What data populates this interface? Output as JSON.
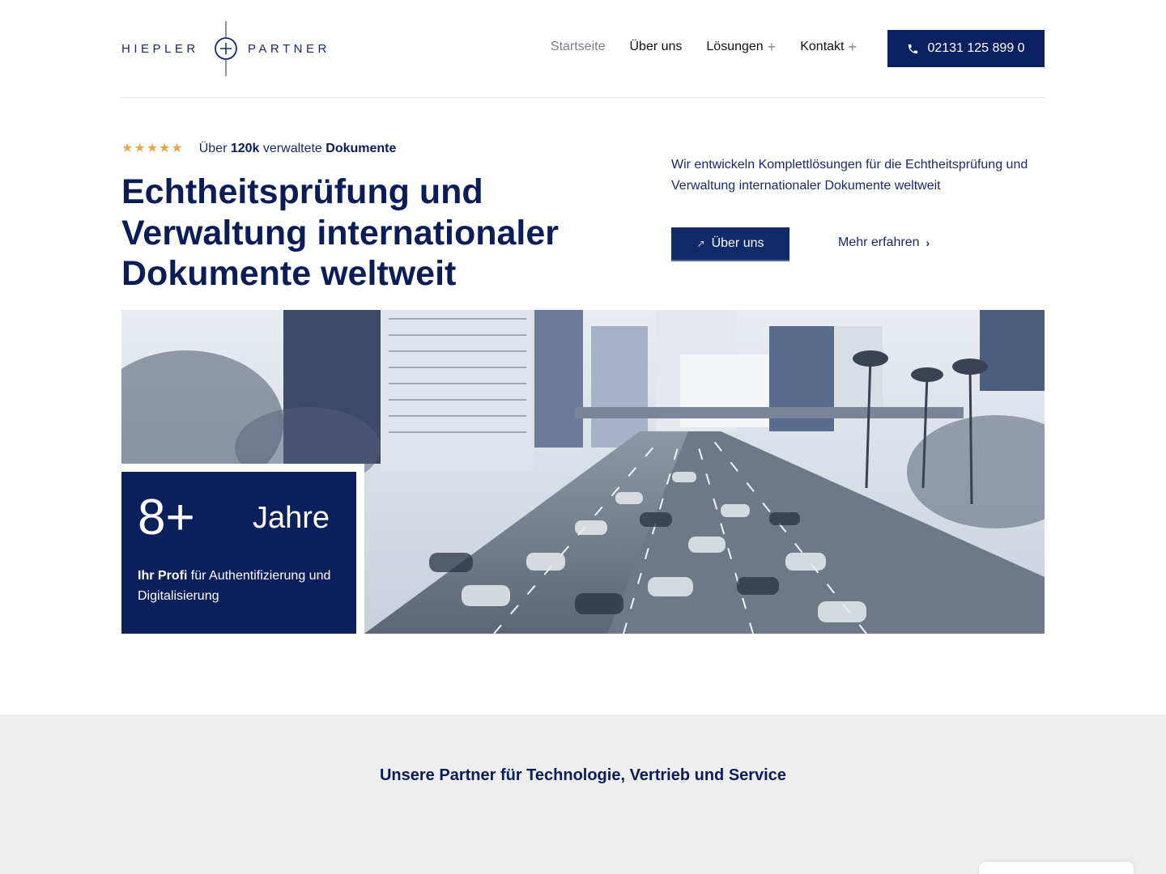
{
  "header": {
    "logo_left": "HIEPLER",
    "logo_right": "PARTNER",
    "nav": [
      {
        "label": "Startseite",
        "has_plus": false,
        "active": true
      },
      {
        "label": "Über uns",
        "has_plus": false,
        "active": false
      },
      {
        "label": "Lösungen",
        "has_plus": true,
        "active": false
      },
      {
        "label": "Kontakt",
        "has_plus": true,
        "active": false
      }
    ],
    "phone": "02131 125 899 0"
  },
  "hero": {
    "rating_prefix": "Über",
    "rating_count": "120k",
    "rating_mid": "verwaltete",
    "rating_suffix": "Dokumente",
    "headline_b1": "Echtheitsprüfung",
    "headline_t1": "und",
    "headline_b2": "Verwaltung",
    "headline_t2": "internationaler Dokumente weltweit",
    "intro": "Wir entwickeln Komplettlösungen für die Echtheitsprüfung und Verwaltung internationaler Dokumente weltweit",
    "about_button": "Über uns",
    "more_link": "Mehr erfahren"
  },
  "stat": {
    "number": "8+",
    "unit": "Jahre",
    "desc_bold": "Ihr Profi",
    "desc_rest": "für Authentifizierung und Digitalisierung"
  },
  "partners": {
    "title": "Unsere Partner für Technologie, Vertrieb und Service"
  },
  "colors": {
    "navy": "#0b1f5c",
    "star": "#e9a94b",
    "band": "#eeeeef"
  }
}
